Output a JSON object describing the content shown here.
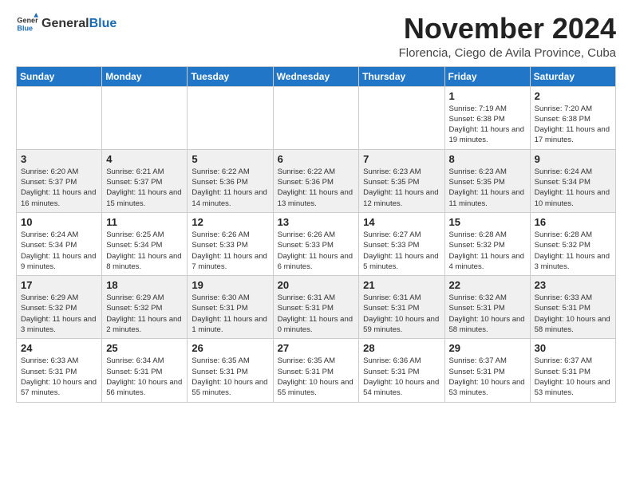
{
  "logo": {
    "general": "General",
    "blue": "Blue"
  },
  "header": {
    "month": "November 2024",
    "location": "Florencia, Ciego de Avila Province, Cuba"
  },
  "days_of_week": [
    "Sunday",
    "Monday",
    "Tuesday",
    "Wednesday",
    "Thursday",
    "Friday",
    "Saturday"
  ],
  "weeks": [
    [
      {
        "day": "",
        "info": ""
      },
      {
        "day": "",
        "info": ""
      },
      {
        "day": "",
        "info": ""
      },
      {
        "day": "",
        "info": ""
      },
      {
        "day": "",
        "info": ""
      },
      {
        "day": "1",
        "info": "Sunrise: 7:19 AM\nSunset: 6:38 PM\nDaylight: 11 hours and 19 minutes."
      },
      {
        "day": "2",
        "info": "Sunrise: 7:20 AM\nSunset: 6:38 PM\nDaylight: 11 hours and 17 minutes."
      }
    ],
    [
      {
        "day": "3",
        "info": "Sunrise: 6:20 AM\nSunset: 5:37 PM\nDaylight: 11 hours and 16 minutes."
      },
      {
        "day": "4",
        "info": "Sunrise: 6:21 AM\nSunset: 5:37 PM\nDaylight: 11 hours and 15 minutes."
      },
      {
        "day": "5",
        "info": "Sunrise: 6:22 AM\nSunset: 5:36 PM\nDaylight: 11 hours and 14 minutes."
      },
      {
        "day": "6",
        "info": "Sunrise: 6:22 AM\nSunset: 5:36 PM\nDaylight: 11 hours and 13 minutes."
      },
      {
        "day": "7",
        "info": "Sunrise: 6:23 AM\nSunset: 5:35 PM\nDaylight: 11 hours and 12 minutes."
      },
      {
        "day": "8",
        "info": "Sunrise: 6:23 AM\nSunset: 5:35 PM\nDaylight: 11 hours and 11 minutes."
      },
      {
        "day": "9",
        "info": "Sunrise: 6:24 AM\nSunset: 5:34 PM\nDaylight: 11 hours and 10 minutes."
      }
    ],
    [
      {
        "day": "10",
        "info": "Sunrise: 6:24 AM\nSunset: 5:34 PM\nDaylight: 11 hours and 9 minutes."
      },
      {
        "day": "11",
        "info": "Sunrise: 6:25 AM\nSunset: 5:34 PM\nDaylight: 11 hours and 8 minutes."
      },
      {
        "day": "12",
        "info": "Sunrise: 6:26 AM\nSunset: 5:33 PM\nDaylight: 11 hours and 7 minutes."
      },
      {
        "day": "13",
        "info": "Sunrise: 6:26 AM\nSunset: 5:33 PM\nDaylight: 11 hours and 6 minutes."
      },
      {
        "day": "14",
        "info": "Sunrise: 6:27 AM\nSunset: 5:33 PM\nDaylight: 11 hours and 5 minutes."
      },
      {
        "day": "15",
        "info": "Sunrise: 6:28 AM\nSunset: 5:32 PM\nDaylight: 11 hours and 4 minutes."
      },
      {
        "day": "16",
        "info": "Sunrise: 6:28 AM\nSunset: 5:32 PM\nDaylight: 11 hours and 3 minutes."
      }
    ],
    [
      {
        "day": "17",
        "info": "Sunrise: 6:29 AM\nSunset: 5:32 PM\nDaylight: 11 hours and 3 minutes."
      },
      {
        "day": "18",
        "info": "Sunrise: 6:29 AM\nSunset: 5:32 PM\nDaylight: 11 hours and 2 minutes."
      },
      {
        "day": "19",
        "info": "Sunrise: 6:30 AM\nSunset: 5:31 PM\nDaylight: 11 hours and 1 minute."
      },
      {
        "day": "20",
        "info": "Sunrise: 6:31 AM\nSunset: 5:31 PM\nDaylight: 11 hours and 0 minutes."
      },
      {
        "day": "21",
        "info": "Sunrise: 6:31 AM\nSunset: 5:31 PM\nDaylight: 10 hours and 59 minutes."
      },
      {
        "day": "22",
        "info": "Sunrise: 6:32 AM\nSunset: 5:31 PM\nDaylight: 10 hours and 58 minutes."
      },
      {
        "day": "23",
        "info": "Sunrise: 6:33 AM\nSunset: 5:31 PM\nDaylight: 10 hours and 58 minutes."
      }
    ],
    [
      {
        "day": "24",
        "info": "Sunrise: 6:33 AM\nSunset: 5:31 PM\nDaylight: 10 hours and 57 minutes."
      },
      {
        "day": "25",
        "info": "Sunrise: 6:34 AM\nSunset: 5:31 PM\nDaylight: 10 hours and 56 minutes."
      },
      {
        "day": "26",
        "info": "Sunrise: 6:35 AM\nSunset: 5:31 PM\nDaylight: 10 hours and 55 minutes."
      },
      {
        "day": "27",
        "info": "Sunrise: 6:35 AM\nSunset: 5:31 PM\nDaylight: 10 hours and 55 minutes."
      },
      {
        "day": "28",
        "info": "Sunrise: 6:36 AM\nSunset: 5:31 PM\nDaylight: 10 hours and 54 minutes."
      },
      {
        "day": "29",
        "info": "Sunrise: 6:37 AM\nSunset: 5:31 PM\nDaylight: 10 hours and 53 minutes."
      },
      {
        "day": "30",
        "info": "Sunrise: 6:37 AM\nSunset: 5:31 PM\nDaylight: 10 hours and 53 minutes."
      }
    ]
  ]
}
